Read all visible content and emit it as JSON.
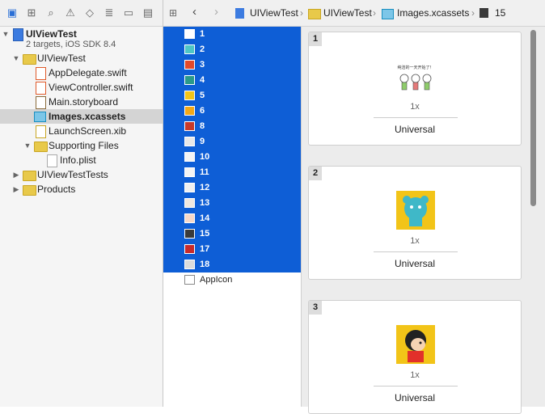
{
  "project": {
    "name": "UIViewTest",
    "subtitle": "2 targets, iOS SDK 8.4"
  },
  "tree": {
    "group": "UIViewTest",
    "files": [
      "AppDelegate.swift",
      "ViewController.swift",
      "Main.storyboard",
      "Images.xcassets",
      "LaunchScreen.xib"
    ],
    "supporting": "Supporting Files",
    "info": "Info.plist",
    "tests": "UIViewTestTests",
    "products": "Products"
  },
  "breadcrumb": [
    "UIViewTest",
    "UIViewTest",
    "Images.xcassets",
    "15"
  ],
  "list": [
    "1",
    "2",
    "3",
    "4",
    "5",
    "6",
    "8",
    "9",
    "10",
    "11",
    "12",
    "13",
    "14",
    "15",
    "17",
    "18",
    "AppIcon"
  ],
  "cards": [
    {
      "num": "1",
      "scale": "1x",
      "device": "Universal"
    },
    {
      "num": "2",
      "scale": "1x",
      "device": "Universal"
    },
    {
      "num": "3",
      "scale": "1x",
      "device": "Universal"
    }
  ],
  "image1_caption": "纯洁的一天开始了！",
  "colors": {
    "selection": "#0e5ed6",
    "folder": "#e8c94a",
    "sticker_bg": "#f2c418"
  }
}
